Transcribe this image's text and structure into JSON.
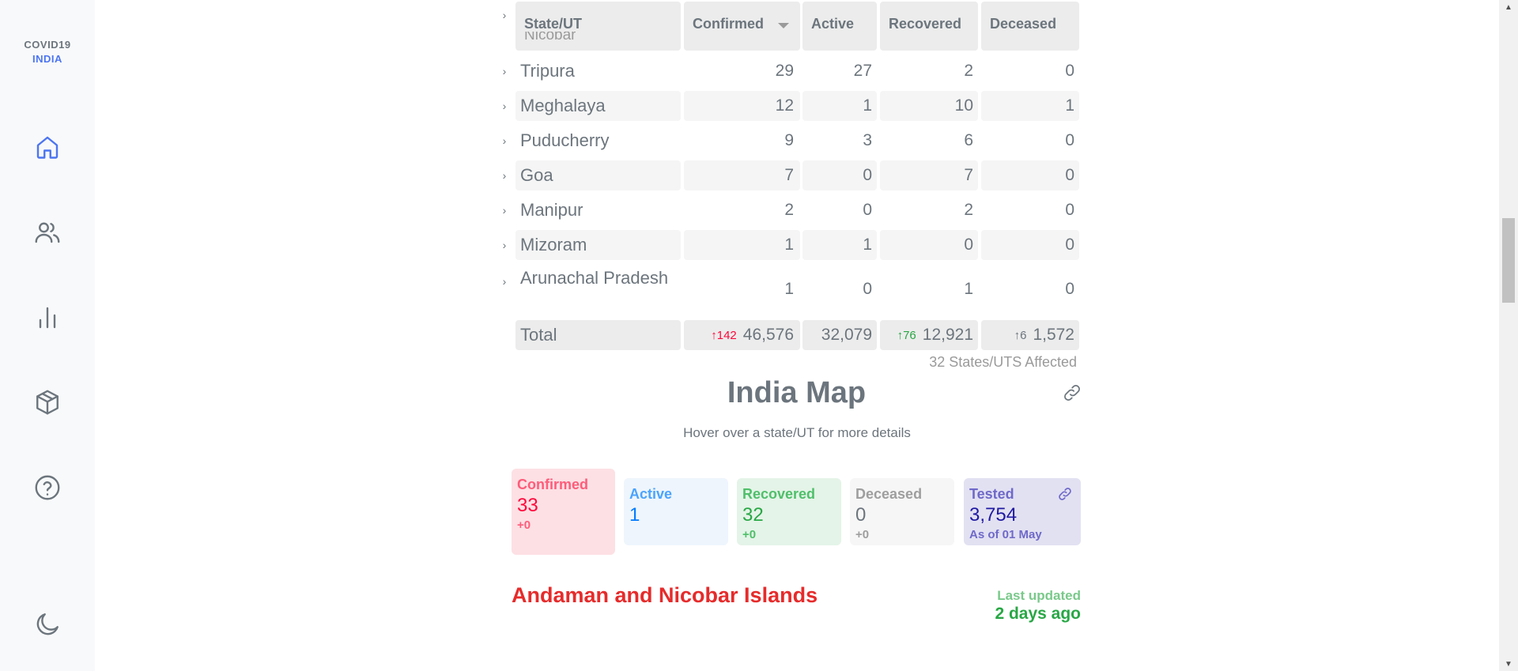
{
  "brand": {
    "line1": "COVID19",
    "line2": "INDIA"
  },
  "nav": {
    "items": [
      {
        "icon": "home-icon",
        "active": true
      },
      {
        "icon": "users-icon",
        "active": false
      },
      {
        "icon": "bar-chart-icon",
        "active": false
      },
      {
        "icon": "package-icon",
        "active": false
      },
      {
        "icon": "help-icon",
        "active": false
      }
    ],
    "theme_icon": "moon-icon"
  },
  "table": {
    "headers": {
      "state": "State/UT",
      "confirmed": "Confirmed",
      "active": "Active",
      "recovered": "Recovered",
      "deceased": "Deceased"
    },
    "clipped_row_text": "Nicobar Islands",
    "rows": [
      {
        "state": "Tripura",
        "confirmed": "29",
        "active": "27",
        "recovered": "2",
        "deceased": "0"
      },
      {
        "state": "Meghalaya",
        "confirmed": "12",
        "active": "1",
        "recovered": "10",
        "deceased": "1"
      },
      {
        "state": "Puducherry",
        "confirmed": "9",
        "active": "3",
        "recovered": "6",
        "deceased": "0"
      },
      {
        "state": "Goa",
        "confirmed": "7",
        "active": "0",
        "recovered": "7",
        "deceased": "0"
      },
      {
        "state": "Manipur",
        "confirmed": "2",
        "active": "0",
        "recovered": "2",
        "deceased": "0"
      },
      {
        "state": "Mizoram",
        "confirmed": "1",
        "active": "1",
        "recovered": "0",
        "deceased": "0"
      },
      {
        "state": "Arunachal Pradesh",
        "confirmed": "1",
        "active": "0",
        "recovered": "1",
        "deceased": "0"
      }
    ],
    "total": {
      "label": "Total",
      "confirmed_delta": "↑142",
      "confirmed": "46,576",
      "active": "32,079",
      "recovered_delta": "↑76",
      "recovered": "12,921",
      "deceased_delta": "↑6",
      "deceased": "1,572"
    },
    "affected": "32 States/UTS Affected"
  },
  "map": {
    "title": "India Map",
    "subtitle": "Hover over a state/UT for more details",
    "link_icon": "share-link-icon"
  },
  "stats": {
    "confirmed": {
      "label": "Confirmed",
      "value": "33",
      "delta": "+0"
    },
    "active": {
      "label": "Active",
      "value": "1"
    },
    "recovered": {
      "label": "Recovered",
      "value": "32",
      "delta": "+0"
    },
    "deceased": {
      "label": "Deceased",
      "value": "0",
      "delta": "+0"
    },
    "tested": {
      "label": "Tested",
      "value": "3,754",
      "sub": "As of 01 May",
      "icon": "link-icon"
    }
  },
  "region": {
    "name": "Andaman and Nicobar Islands",
    "last_updated_label": "Last updated",
    "last_updated_value": "2 days ago"
  },
  "colors": {
    "accent": "#4c75f2",
    "confirmed": "#ff073a",
    "active": "#007bff",
    "recovered": "#28a745",
    "deceased": "#6c757d",
    "tested": "#201aa2"
  }
}
